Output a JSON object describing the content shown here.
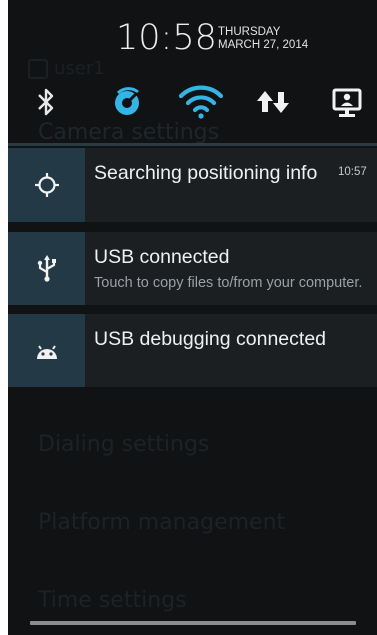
{
  "header": {
    "time": "10:58",
    "day": "THURSDAY",
    "date": "MARCH 27, 2014"
  },
  "quick_settings": [
    {
      "icon": "bluetooth-icon",
      "state": "on"
    },
    {
      "icon": "location-icon",
      "state": "on"
    },
    {
      "icon": "wifi-icon",
      "state": "on"
    },
    {
      "icon": "mobile-data-icon",
      "state": "on"
    },
    {
      "icon": "screen-cast-icon",
      "state": "on"
    }
  ],
  "notifications": [
    {
      "icon": "gps-icon",
      "title": "Searching positioning info",
      "time": "10:57"
    },
    {
      "icon": "usb-icon",
      "title": "USB connected",
      "subtitle": "Touch to copy files to/from your computer."
    },
    {
      "icon": "android-debug-icon",
      "title": "USB debugging connected"
    }
  ],
  "background_settings": {
    "user": "user1",
    "items": [
      "Camera settings",
      "Dialing settings",
      "Platform management",
      "Time settings"
    ]
  },
  "colors": {
    "accent": "#33b5e5",
    "icon_box": "#233a46",
    "card": "#1c1f21",
    "shade": "#111214"
  }
}
